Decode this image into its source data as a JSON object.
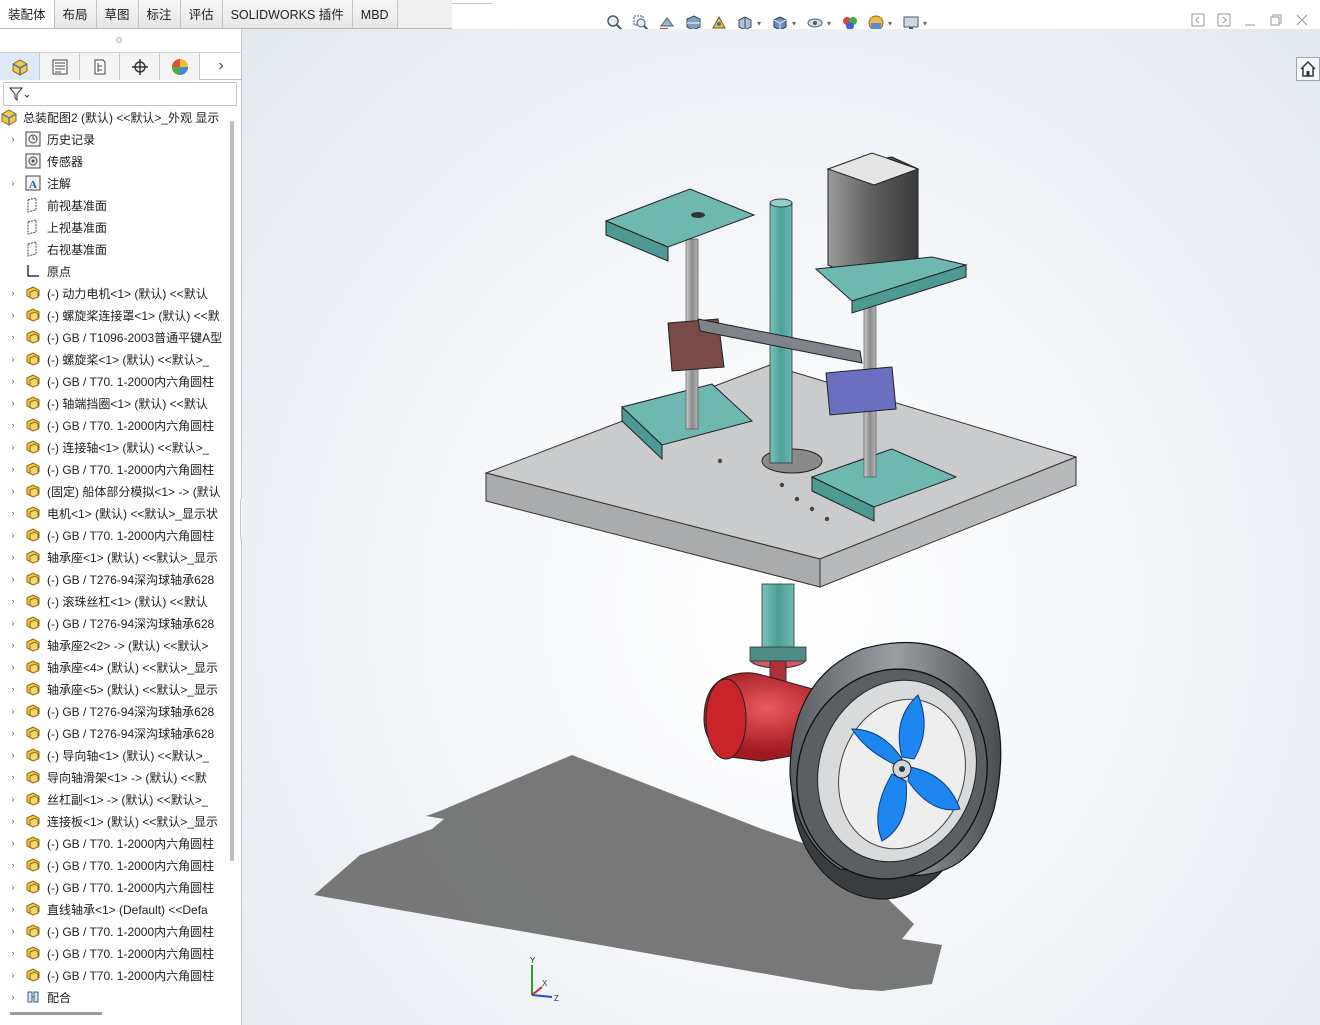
{
  "tabs": [
    {
      "label": "装配体",
      "active": true
    },
    {
      "label": "布局"
    },
    {
      "label": "草图"
    },
    {
      "label": "标注"
    },
    {
      "label": "评估"
    },
    {
      "label": "SOLIDWORKS 插件"
    },
    {
      "label": "MBD"
    }
  ],
  "hud_icons": [
    "zoom-to-fit-icon",
    "zoom-area-icon",
    "previous-view-icon",
    "section-view-icon",
    "dynamic-annotation-icon",
    "view-orientation-icon",
    "display-style-icon",
    "hide-show-icon",
    "edit-appearance-icon",
    "apply-scene-icon",
    "view-settings-icon"
  ],
  "window_controls": [
    "tile-left-icon",
    "tile-right-icon",
    "minimize-icon",
    "restore-icon",
    "close-icon"
  ],
  "manager_tabs": [
    "featuremanager-icon",
    "propertymanager-icon",
    "configurationmanager-icon",
    "dimxpert-icon",
    "displaymanager-icon"
  ],
  "tree": {
    "root": "总装配图2 (默认) <<默认>_外观 显示",
    "items": [
      {
        "label": "历史记录",
        "icon": "history",
        "expand": true
      },
      {
        "label": "传感器",
        "icon": "sensor",
        "expand": false
      },
      {
        "label": "注解",
        "icon": "annotation",
        "expand": true
      },
      {
        "label": "前视基准面",
        "icon": "plane",
        "expand": false
      },
      {
        "label": "上视基准面",
        "icon": "plane",
        "expand": false
      },
      {
        "label": "右视基准面",
        "icon": "plane",
        "expand": false
      },
      {
        "label": "原点",
        "icon": "origin",
        "expand": false
      },
      {
        "label": "(-) 动力电机<1> (默认) <<默认",
        "icon": "part",
        "expand": true
      },
      {
        "label": "(-) 螺旋桨连接罩<1> (默认) <<默",
        "icon": "part",
        "expand": true
      },
      {
        "label": "(-) GB / T1096-2003普通平键A型",
        "icon": "part",
        "expand": true
      },
      {
        "label": "(-) 螺旋桨<1> (默认) <<默认>_",
        "icon": "part",
        "expand": true
      },
      {
        "label": "(-) GB / T70. 1-2000内六角圆柱",
        "icon": "part",
        "expand": true
      },
      {
        "label": "(-) 轴端挡圈<1> (默认) <<默认",
        "icon": "part",
        "expand": true
      },
      {
        "label": "(-) GB / T70. 1-2000内六角圆柱",
        "icon": "part",
        "expand": true
      },
      {
        "label": "(-) 连接轴<1> (默认) <<默认>_",
        "icon": "part",
        "expand": true
      },
      {
        "label": "(-) GB / T70. 1-2000内六角圆柱",
        "icon": "part",
        "expand": true
      },
      {
        "label": "(固定) 船体部分模拟<1> -> (默认",
        "icon": "part",
        "expand": true
      },
      {
        "label": "电机<1> (默认) <<默认>_显示状",
        "icon": "part",
        "expand": true
      },
      {
        "label": "(-) GB / T70. 1-2000内六角圆柱",
        "icon": "part",
        "expand": true
      },
      {
        "label": "轴承座<1> (默认) <<默认>_显示",
        "icon": "part",
        "expand": true
      },
      {
        "label": "(-) GB / T276-94深沟球轴承628",
        "icon": "part",
        "expand": true
      },
      {
        "label": "(-) 滚珠丝杠<1> (默认) <<默认",
        "icon": "part",
        "expand": true
      },
      {
        "label": "(-) GB / T276-94深沟球轴承628",
        "icon": "part",
        "expand": true
      },
      {
        "label": "轴承座2<2> -> (默认) <<默认>",
        "icon": "part",
        "expand": true
      },
      {
        "label": "轴承座<4> (默认) <<默认>_显示",
        "icon": "part",
        "expand": true
      },
      {
        "label": "轴承座<5> (默认) <<默认>_显示",
        "icon": "part",
        "expand": true
      },
      {
        "label": "(-) GB / T276-94深沟球轴承628",
        "icon": "part",
        "expand": true
      },
      {
        "label": "(-) GB / T276-94深沟球轴承628",
        "icon": "part",
        "expand": true
      },
      {
        "label": "(-) 导向轴<1> (默认) <<默认>_",
        "icon": "part",
        "expand": true
      },
      {
        "label": "导向轴滑架<1> -> (默认) <<默",
        "icon": "part",
        "expand": true
      },
      {
        "label": "丝杠副<1> -> (默认) <<默认>_",
        "icon": "part",
        "expand": true
      },
      {
        "label": "连接板<1> (默认) <<默认>_显示",
        "icon": "part",
        "expand": true
      },
      {
        "label": "(-) GB / T70. 1-2000内六角圆柱",
        "icon": "part",
        "expand": true
      },
      {
        "label": "(-) GB / T70. 1-2000内六角圆柱",
        "icon": "part",
        "expand": true
      },
      {
        "label": "(-) GB / T70. 1-2000内六角圆柱",
        "icon": "part",
        "expand": true
      },
      {
        "label": "直线轴承<1> (Default) <<Defa",
        "icon": "part",
        "expand": true
      },
      {
        "label": "(-) GB / T70. 1-2000内六角圆柱",
        "icon": "part",
        "expand": true
      },
      {
        "label": "(-) GB / T70. 1-2000内六角圆柱",
        "icon": "part",
        "expand": true
      },
      {
        "label": "(-) GB / T70. 1-2000内六角圆柱",
        "icon": "part",
        "expand": true
      },
      {
        "label": "配合",
        "icon": "mates",
        "expand": true
      }
    ]
  },
  "triad": {
    "x": "X",
    "y": "Y",
    "z": "Z"
  },
  "colors": {
    "bracket": "#6fb8b2",
    "plate": "#c9cbcc",
    "motor_body": "#7a7a7a",
    "red_housing": "#c8242a",
    "propeller": "#1e86f0",
    "duct": "#8a8d90",
    "carriage_brown": "#7a4a46",
    "carriage_purple": "#6a6fc0"
  }
}
